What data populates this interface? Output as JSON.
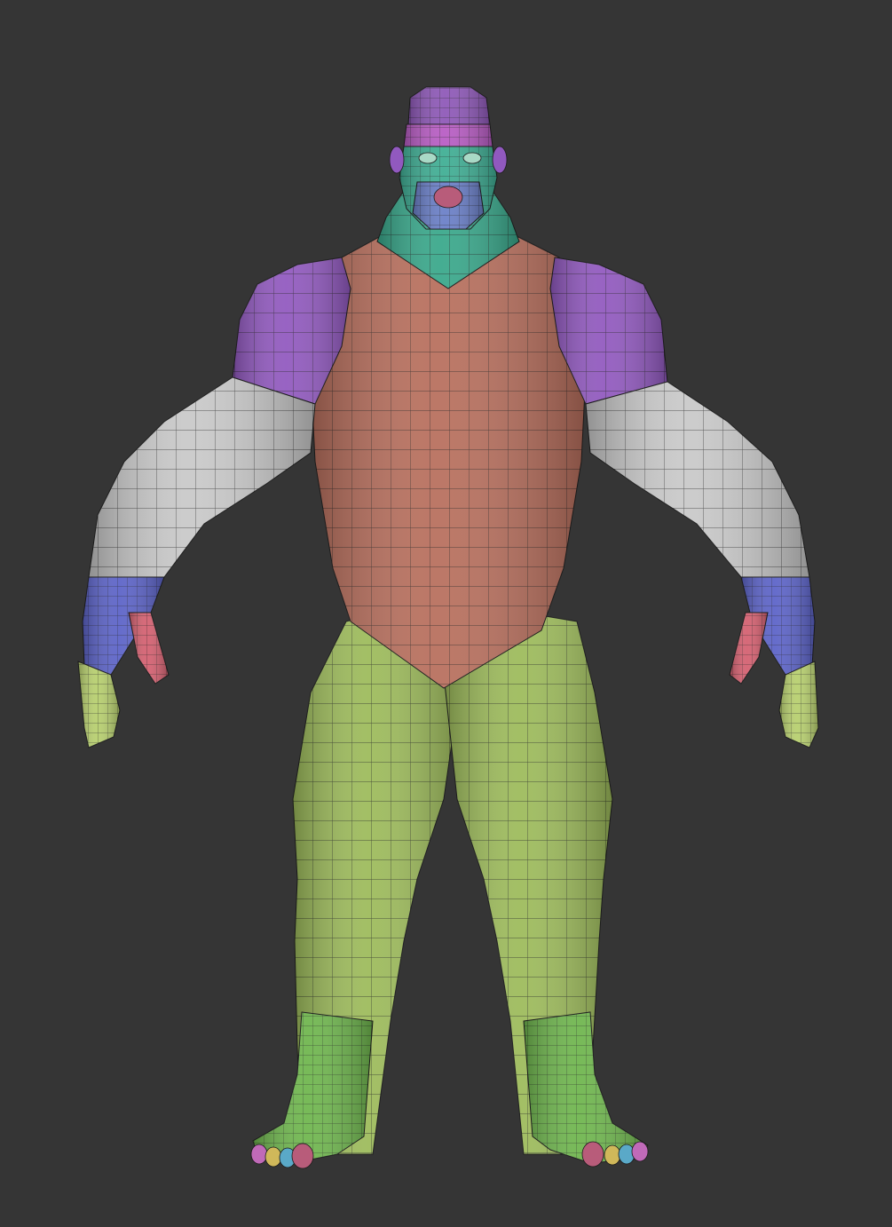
{
  "scene": {
    "background_color": "#353535",
    "wire_color": "#1c1c1c",
    "polygroups": {
      "scalp": "#8e58b8",
      "face_band": "#b85cc4",
      "face_teal": "#3fae94",
      "face_blue": "#6a7fc8",
      "neck": "#39a88b",
      "shoulders": "#9159bf",
      "torso": "#b86f5d",
      "upper_arms": "#c9c9c9",
      "hands": "#5c63c8",
      "thumbs": "#d46070",
      "fingers": "#b7cf6e",
      "legs": "#9dbb5b",
      "feet": "#6fb64e",
      "toe_colors": [
        "#c06ab8",
        "#d0b85a",
        "#5aa9c8",
        "#b85c7a",
        "#8a6ac8"
      ]
    }
  }
}
